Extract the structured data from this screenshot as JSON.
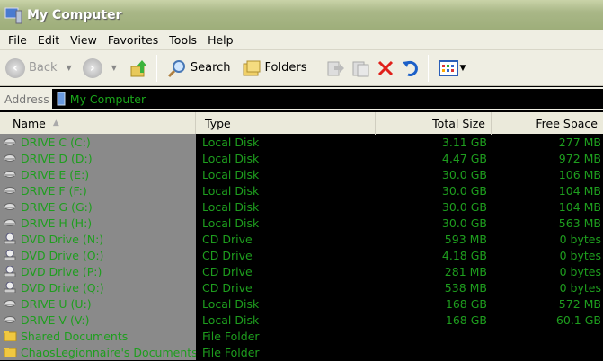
{
  "window": {
    "title": "My Computer"
  },
  "menu": [
    "File",
    "Edit",
    "View",
    "Favorites",
    "Tools",
    "Help"
  ],
  "toolbar": {
    "back": "Back",
    "search": "Search",
    "folders": "Folders"
  },
  "address": {
    "label": "Address",
    "value": "My Computer"
  },
  "columns": [
    "Name",
    "Type",
    "Total Size",
    "Free Space"
  ],
  "rows": [
    {
      "name": "DRIVE C (C:)",
      "type": "Local Disk",
      "total": "3.11 GB",
      "free": "277 MB",
      "icon": "hard-drive-icon"
    },
    {
      "name": "DRIVE D (D:)",
      "type": "Local Disk",
      "total": "4.47 GB",
      "free": "972 MB",
      "icon": "hard-drive-icon"
    },
    {
      "name": "DRIVE E (E:)",
      "type": "Local Disk",
      "total": "30.0 GB",
      "free": "106 MB",
      "icon": "hard-drive-icon"
    },
    {
      "name": "DRIVE F (F:)",
      "type": "Local Disk",
      "total": "30.0 GB",
      "free": "104 MB",
      "icon": "hard-drive-icon"
    },
    {
      "name": "DRIVE G (G:)",
      "type": "Local Disk",
      "total": "30.0 GB",
      "free": "104 MB",
      "icon": "hard-drive-icon"
    },
    {
      "name": "DRIVE H (H:)",
      "type": "Local Disk",
      "total": "30.0 GB",
      "free": "563 MB",
      "icon": "hard-drive-icon"
    },
    {
      "name": "DVD Drive (N:)",
      "type": "CD Drive",
      "total": "593 MB",
      "free": "0 bytes",
      "icon": "dvd-drive-icon"
    },
    {
      "name": "DVD Drive (O:)",
      "type": "CD Drive",
      "total": "4.18 GB",
      "free": "0 bytes",
      "icon": "dvd-drive-icon"
    },
    {
      "name": "DVD Drive (P:)",
      "type": "CD Drive",
      "total": "281 MB",
      "free": "0 bytes",
      "icon": "dvd-drive-icon"
    },
    {
      "name": "DVD Drive (Q:)",
      "type": "CD Drive",
      "total": "538 MB",
      "free": "0 bytes",
      "icon": "dvd-drive-icon"
    },
    {
      "name": "DRIVE U (U:)",
      "type": "Local Disk",
      "total": "168 GB",
      "free": "572 MB",
      "icon": "hard-drive-icon"
    },
    {
      "name": "DRIVE V (V:)",
      "type": "Local Disk",
      "total": "168 GB",
      "free": "60.1 GB",
      "icon": "hard-drive-icon"
    },
    {
      "name": "Shared Documents",
      "type": "File Folder",
      "total": "",
      "free": "",
      "icon": "folder-icon"
    },
    {
      "name": "ChaosLegionnaire's Documents",
      "type": "File Folder",
      "total": "",
      "free": "",
      "icon": "folder-icon"
    }
  ]
}
